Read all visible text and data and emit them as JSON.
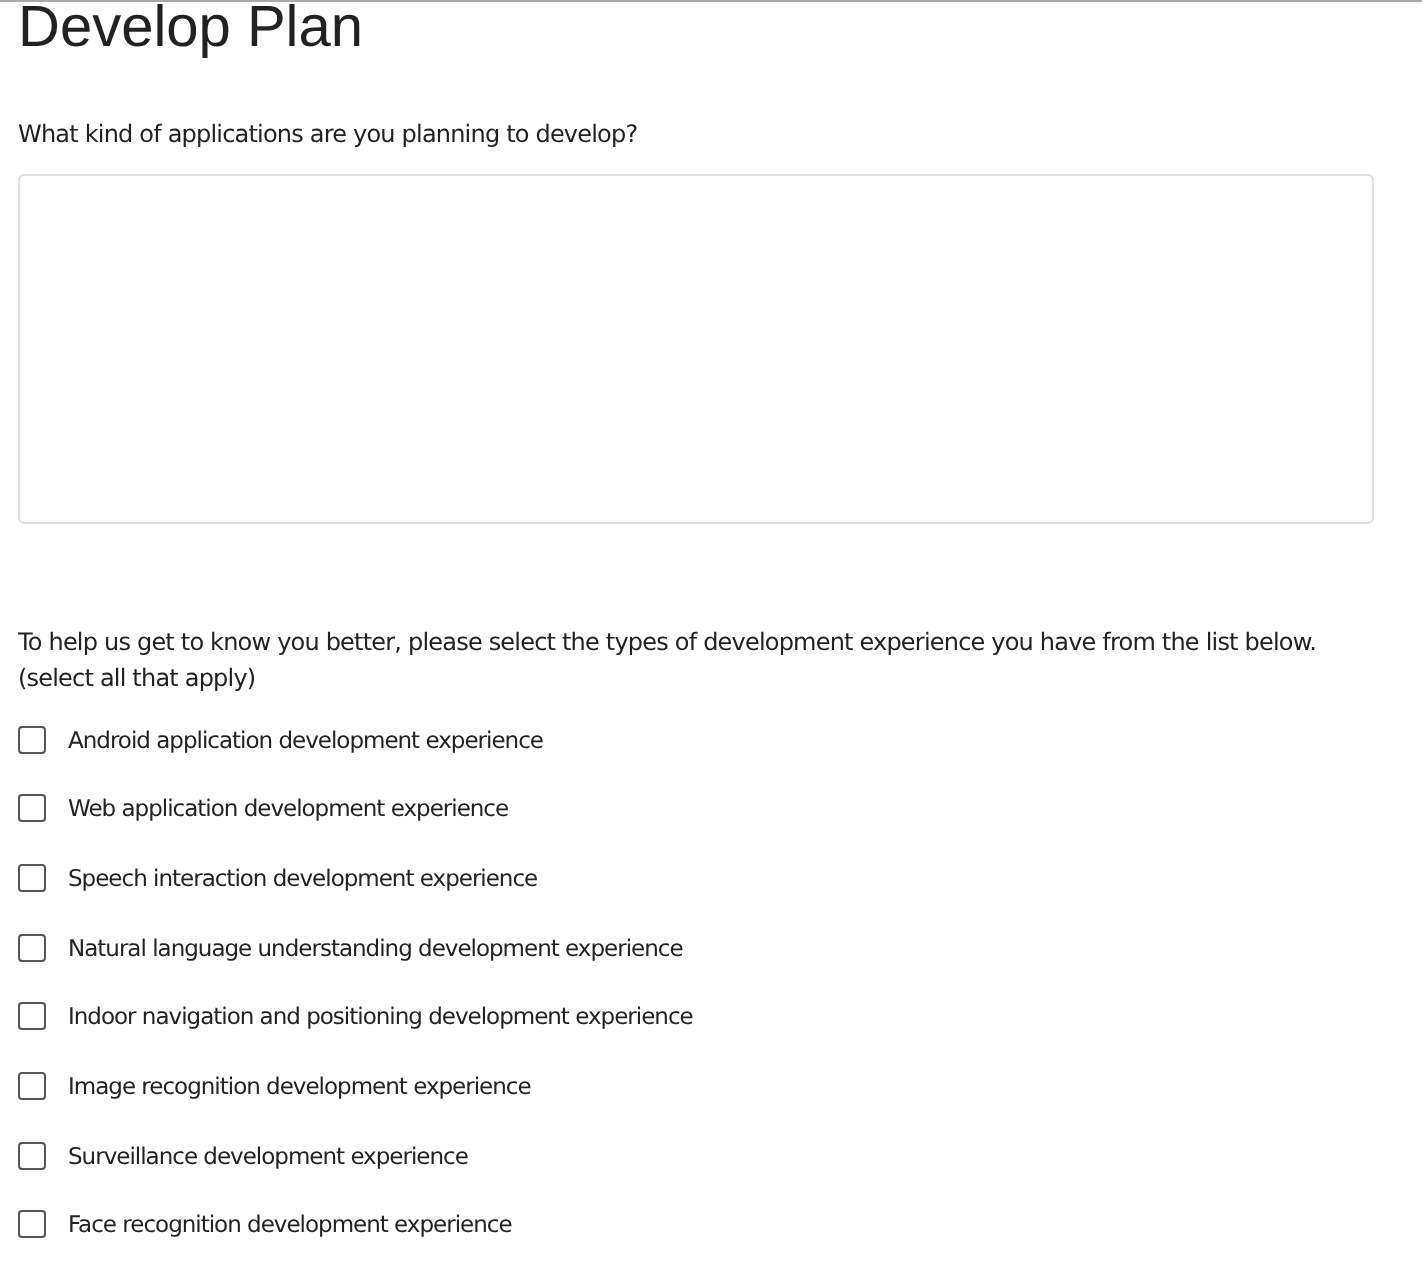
{
  "title": "Develop Plan",
  "question": {
    "label": "What kind of applications are you planning to develop?"
  },
  "experience": {
    "prompt": "To help us get to know you better, please select the types of development experience you have from the list below.",
    "hint": "(select all that apply)",
    "options": [
      {
        "label": "Android application development experience",
        "checked": false
      },
      {
        "label": "Web application development experience",
        "checked": false
      },
      {
        "label": "Speech interaction development experience",
        "checked": false
      },
      {
        "label": "Natural language understanding development experience",
        "checked": false
      },
      {
        "label": "Indoor navigation and positioning development experience",
        "checked": false
      },
      {
        "label": "Image recognition development experience",
        "checked": false
      },
      {
        "label": "Surveillance development experience",
        "checked": false
      },
      {
        "label": "Face recognition development experience",
        "checked": false
      }
    ]
  }
}
